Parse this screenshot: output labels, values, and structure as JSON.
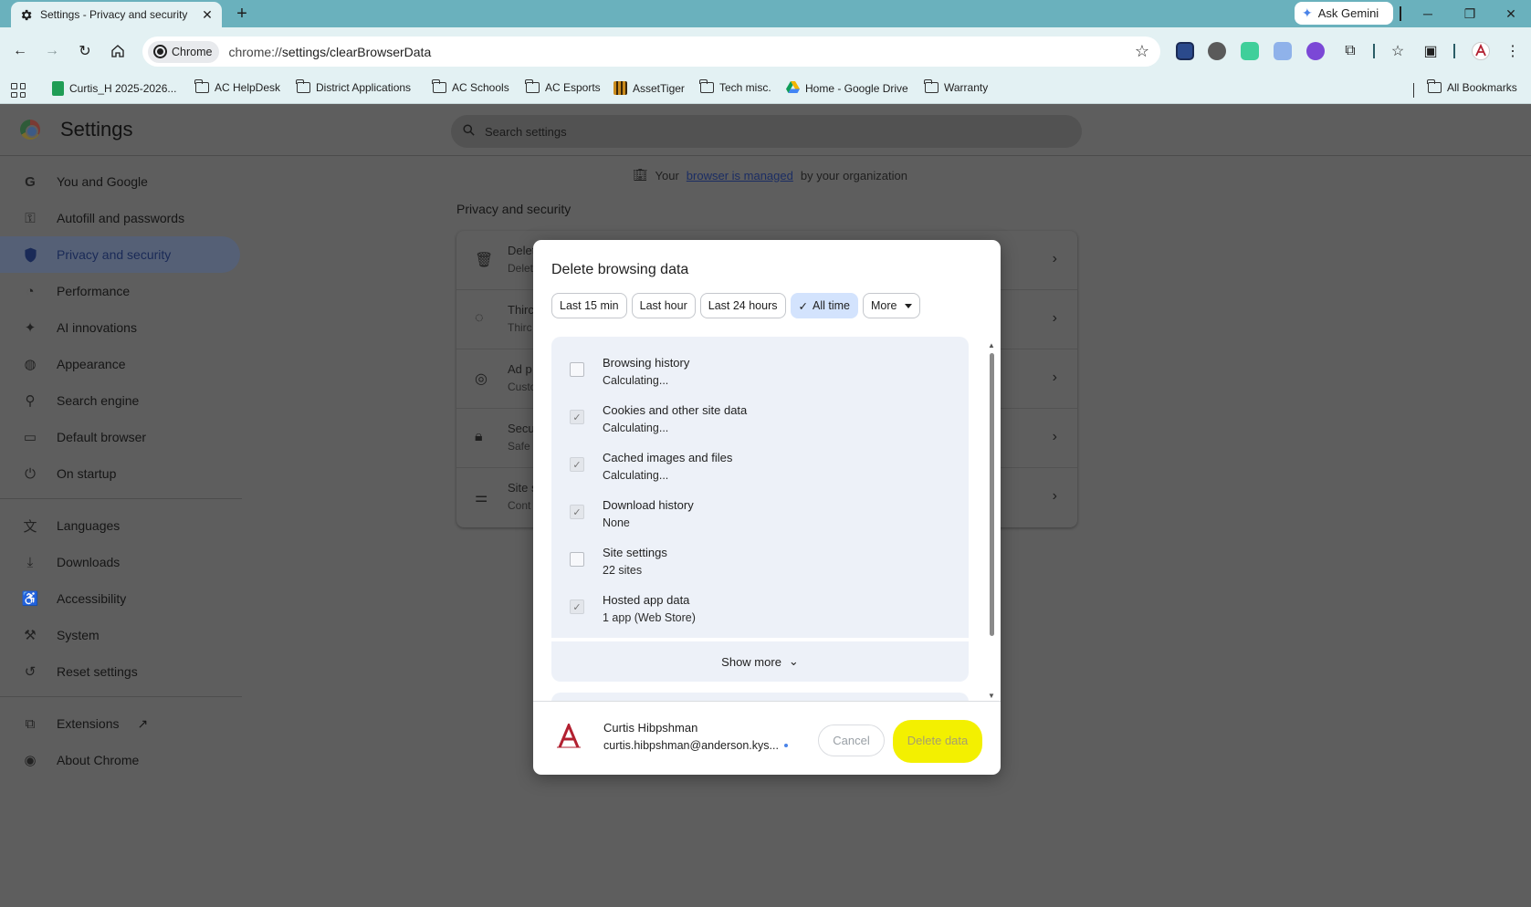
{
  "tab": {
    "title": "Settings - Privacy and security",
    "close": "✕"
  },
  "window": {
    "new_tab": "+",
    "gemini_label": "Ask Gemini",
    "minimize": "─",
    "restore": "❐",
    "close": "✕"
  },
  "toolbar": {
    "chip_label": "Chrome",
    "url_prefix": "chrome://",
    "url_path": "settings/clearBrowserData"
  },
  "bookmarks": [
    {
      "label": "Curtis_H 2025-2026...",
      "icon": "sheets-icon"
    },
    {
      "label": "AC HelpDesk",
      "icon": "folder-icon"
    },
    {
      "label": "District Applications",
      "icon": "folder-icon"
    },
    {
      "label": "AC Schools",
      "icon": "folder-icon"
    },
    {
      "label": "AC Esports",
      "icon": "folder-icon"
    },
    {
      "label": "AssetTiger",
      "icon": "tiger-icon"
    },
    {
      "label": "Tech misc.",
      "icon": "folder-icon"
    },
    {
      "label": "Home - Google Drive",
      "icon": "drive-icon"
    },
    {
      "label": "Warranty",
      "icon": "folder-icon"
    }
  ],
  "all_bookmarks": "All Bookmarks",
  "settings": {
    "title": "Settings",
    "search_placeholder": "Search settings",
    "managed_prefix": "Your",
    "managed_link": "browser is managed",
    "managed_suffix": "by your organization",
    "section_title": "Privacy and security",
    "rows": [
      {
        "title": "Delet",
        "subtitle": "Delet"
      },
      {
        "title": "Thirc",
        "subtitle": "Thirc"
      },
      {
        "title": "Ad p",
        "subtitle": "Custo"
      },
      {
        "title": "Secu",
        "subtitle": "Safe"
      },
      {
        "title": "Site s",
        "subtitle": "Cont"
      }
    ]
  },
  "nav": [
    {
      "label": "You and Google",
      "icon": "google-icon"
    },
    {
      "label": "Autofill and passwords",
      "icon": "key-icon"
    },
    {
      "label": "Privacy and security",
      "icon": "shield-icon",
      "active": true
    },
    {
      "label": "Performance",
      "icon": "speedometer-icon"
    },
    {
      "label": "AI innovations",
      "icon": "sparkle-icon"
    },
    {
      "label": "Appearance",
      "icon": "palette-icon"
    },
    {
      "label": "Search engine",
      "icon": "search-icon"
    },
    {
      "label": "Default browser",
      "icon": "browser-window-icon"
    },
    {
      "label": "On startup",
      "icon": "power-icon"
    },
    {
      "label": "Languages",
      "icon": "translate-icon"
    },
    {
      "label": "Downloads",
      "icon": "download-icon"
    },
    {
      "label": "Accessibility",
      "icon": "accessibility-icon"
    },
    {
      "label": "System",
      "icon": "wrench-icon"
    },
    {
      "label": "Reset settings",
      "icon": "reset-icon"
    },
    {
      "label": "Extensions",
      "icon": "puzzle-icon"
    },
    {
      "label": "About Chrome",
      "icon": "chrome-icon"
    }
  ],
  "dialog": {
    "title": "Delete browsing data",
    "time_ranges": [
      "Last 15 min",
      "Last hour",
      "Last 24 hours",
      "All time",
      "More"
    ],
    "selected_range": "All time",
    "items": [
      {
        "title": "Browsing history",
        "detail": "Calculating...",
        "checked": false
      },
      {
        "title": "Cookies and other site data",
        "detail": "Calculating...",
        "checked": true
      },
      {
        "title": "Cached images and files",
        "detail": "Calculating...",
        "checked": true
      },
      {
        "title": "Download history",
        "detail": "None",
        "checked": true
      },
      {
        "title": "Site settings",
        "detail": "22 sites",
        "checked": false
      },
      {
        "title": "Hosted app data",
        "detail": "1 app (Web Store)",
        "checked": true
      }
    ],
    "show_more": "Show more",
    "account_name": "Curtis Hibpshman",
    "account_email": "curtis.hibpshman@anderson.kys...",
    "cancel": "Cancel",
    "delete": "Delete data",
    "highlight_color": "#f3f000"
  }
}
